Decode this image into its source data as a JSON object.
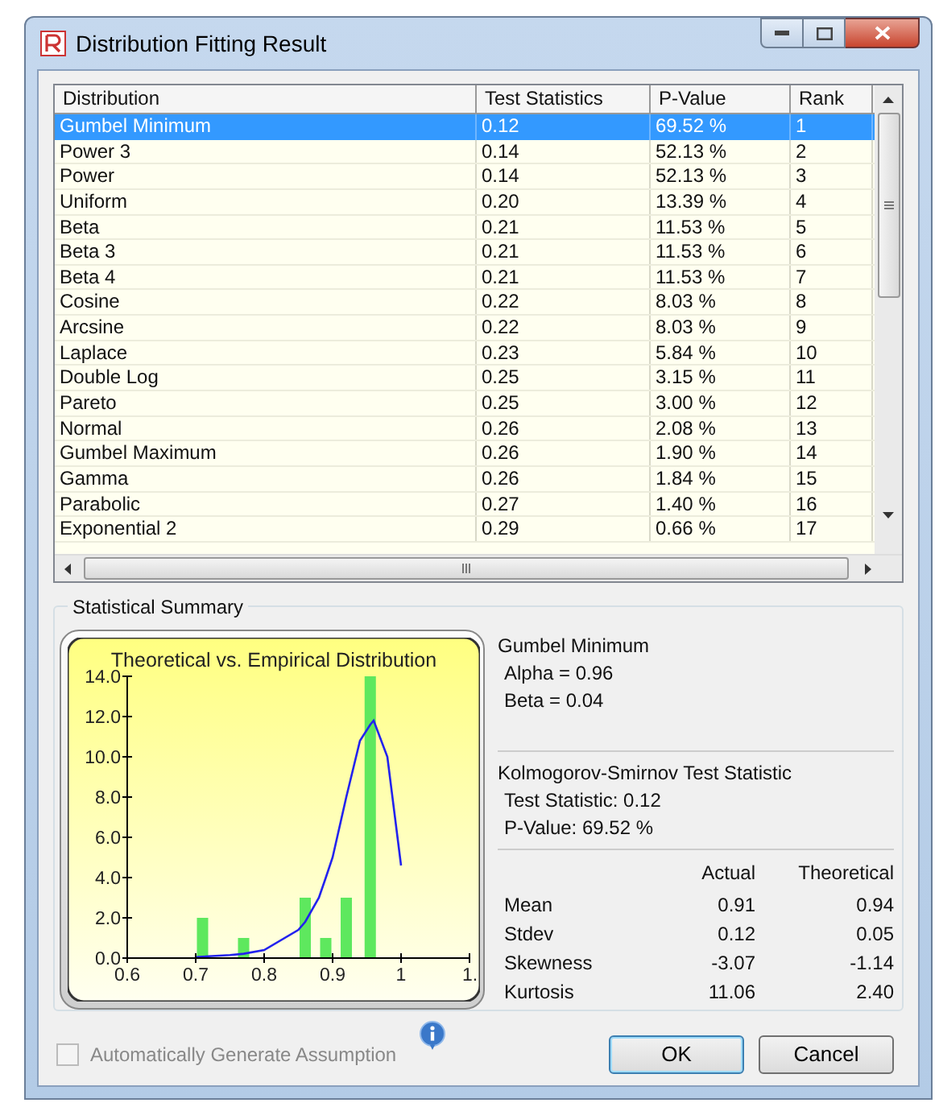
{
  "window": {
    "title": "Distribution Fitting Result"
  },
  "table": {
    "columns": [
      "Distribution",
      "Test Statistics",
      "P-Value",
      "Rank"
    ],
    "rows": [
      {
        "cells": [
          "Gumbel Minimum",
          "0.12",
          "69.52 %",
          "1"
        ],
        "selected": true
      },
      {
        "cells": [
          "Power 3",
          "0.14",
          "52.13 %",
          "2"
        ],
        "selected": false
      },
      {
        "cells": [
          "Power",
          "0.14",
          "52.13 %",
          "3"
        ],
        "selected": false
      },
      {
        "cells": [
          "Uniform",
          "0.20",
          "13.39 %",
          "4"
        ],
        "selected": false
      },
      {
        "cells": [
          "Beta",
          "0.21",
          "11.53 %",
          "5"
        ],
        "selected": false
      },
      {
        "cells": [
          "Beta 3",
          "0.21",
          "11.53 %",
          "6"
        ],
        "selected": false
      },
      {
        "cells": [
          "Beta 4",
          "0.21",
          "11.53 %",
          "7"
        ],
        "selected": false
      },
      {
        "cells": [
          "Cosine",
          "0.22",
          "8.03 %",
          "8"
        ],
        "selected": false
      },
      {
        "cells": [
          "Arcsine",
          "0.22",
          "8.03 %",
          "9"
        ],
        "selected": false
      },
      {
        "cells": [
          "Laplace",
          "0.23",
          "5.84 %",
          "10"
        ],
        "selected": false
      },
      {
        "cells": [
          "Double Log",
          "0.25",
          "3.15 %",
          "11"
        ],
        "selected": false
      },
      {
        "cells": [
          "Pareto",
          "0.25",
          "3.00 %",
          "12"
        ],
        "selected": false
      },
      {
        "cells": [
          "Normal",
          "0.26",
          "2.08 %",
          "13"
        ],
        "selected": false
      },
      {
        "cells": [
          "Gumbel Maximum",
          "0.26",
          "1.90 %",
          "14"
        ],
        "selected": false
      },
      {
        "cells": [
          "Gamma",
          "0.26",
          "1.84 %",
          "15"
        ],
        "selected": false
      },
      {
        "cells": [
          "Parabolic",
          "0.27",
          "1.40 %",
          "16"
        ],
        "selected": false
      },
      {
        "cells": [
          "Exponential 2",
          "0.29",
          "0.66 %",
          "17"
        ],
        "selected": false
      }
    ]
  },
  "summary": {
    "title": "Statistical Summary",
    "chart_data": {
      "type": "bar",
      "title": "Theoretical vs. Empirical Distribution",
      "x": [
        0.7,
        0.71,
        0.75,
        0.77,
        0.8,
        0.85,
        0.86,
        0.88,
        0.89,
        0.9,
        0.92,
        0.94,
        0.955,
        0.96,
        0.98,
        1.0
      ],
      "series": [
        {
          "type": "bar",
          "color": "#5ee85e",
          "values": [
            null,
            2,
            null,
            1,
            null,
            null,
            3,
            null,
            1,
            null,
            3,
            null,
            14,
            null,
            null,
            null
          ]
        },
        {
          "type": "line",
          "color": "#2222ee",
          "values": [
            0.05,
            0.07,
            0.15,
            0.22,
            0.4,
            1.4,
            1.8,
            3,
            4,
            5,
            8,
            10.8,
            11.6,
            11.8,
            10,
            4.6
          ]
        }
      ],
      "xlim": [
        0.6,
        1.1
      ],
      "ylim": [
        0,
        14
      ],
      "xticks": [
        {
          "value": 0.6,
          "label": "0.6"
        },
        {
          "value": 0.7,
          "label": "0.7"
        },
        {
          "value": 0.8,
          "label": "0.8"
        },
        {
          "value": 0.9,
          "label": "0.9"
        },
        {
          "value": 1.0,
          "label": "1"
        },
        {
          "value": 1.1,
          "label": "1."
        }
      ],
      "yticks": [
        {
          "value": 0,
          "label": "0.0"
        },
        {
          "value": 2,
          "label": "2.0"
        },
        {
          "value": 4,
          "label": "4.0"
        },
        {
          "value": 6,
          "label": "6.0"
        },
        {
          "value": 8,
          "label": "8.0"
        },
        {
          "value": 10,
          "label": "10.0"
        },
        {
          "value": 12,
          "label": "12.0"
        },
        {
          "value": 14,
          "label": "14.0"
        }
      ]
    },
    "distribution": {
      "name": "Gumbel Minimum",
      "params": [
        "Alpha = 0.96",
        "Beta = 0.04"
      ]
    },
    "test": {
      "title": "Kolmogorov-Smirnov Test Statistic",
      "lines": [
        "Test Statistic: 0.12",
        "P-Value: 69.52 %"
      ]
    },
    "moments": {
      "columns": [
        "Actual",
        "Theoretical"
      ],
      "rows": [
        {
          "label": "Mean",
          "actual": "0.91",
          "theoretical": "0.94"
        },
        {
          "label": "Stdev",
          "actual": "0.12",
          "theoretical": "0.05"
        },
        {
          "label": "Skewness",
          "actual": "-3.07",
          "theoretical": "-1.14"
        },
        {
          "label": "Kurtosis",
          "actual": "11.06",
          "theoretical": "2.40"
        }
      ]
    }
  },
  "auto_assumption": {
    "label": "Automatically Generate Assumption",
    "checked": false,
    "disabled": true
  },
  "buttons": [
    "OK",
    "Cancel"
  ]
}
